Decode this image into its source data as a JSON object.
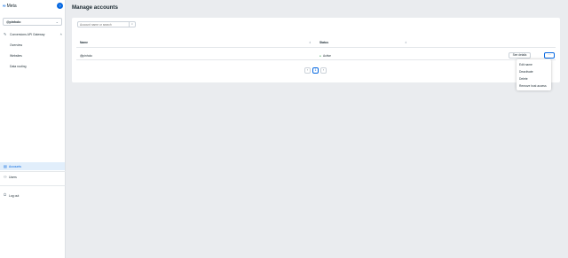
{
  "brand": {
    "logo_mark": "∞",
    "logo_text": "Meta",
    "help_icon": "question-icon"
  },
  "sidebar": {
    "account_select": {
      "value": "@pinholo",
      "icon": "chevron-down-icon"
    },
    "section": {
      "label": "Conversions API Gateway",
      "icon": "wrench-icon",
      "expanded": true
    },
    "sub_items": [
      {
        "label": "Overview"
      },
      {
        "label": "Websites"
      },
      {
        "label": "Data routing"
      }
    ],
    "bottom_items": [
      {
        "label": "Accounts",
        "icon": "accounts-icon",
        "active": true
      },
      {
        "label": "Users",
        "icon": "users-icon"
      },
      {
        "label": "Log out",
        "icon": "logout-icon"
      }
    ]
  },
  "main": {
    "title": "Manage accounts",
    "search": {
      "placeholder": "Account name or search"
    },
    "table": {
      "columns": [
        "Name",
        "Status"
      ],
      "rows": [
        {
          "name": "@pinholo",
          "status": "Active",
          "details_label": "See details",
          "more_label": "···"
        }
      ]
    },
    "pagination": {
      "prev": "‹",
      "current": "1",
      "next": "›"
    },
    "row_menu": [
      "Edit name",
      "Deactivate",
      "Delete",
      "Remove host access"
    ]
  },
  "colors": {
    "accent": "#0668e1",
    "active_bg": "#e1eefb",
    "status_active": "#31a24c",
    "page_bg": "#eaecef"
  }
}
